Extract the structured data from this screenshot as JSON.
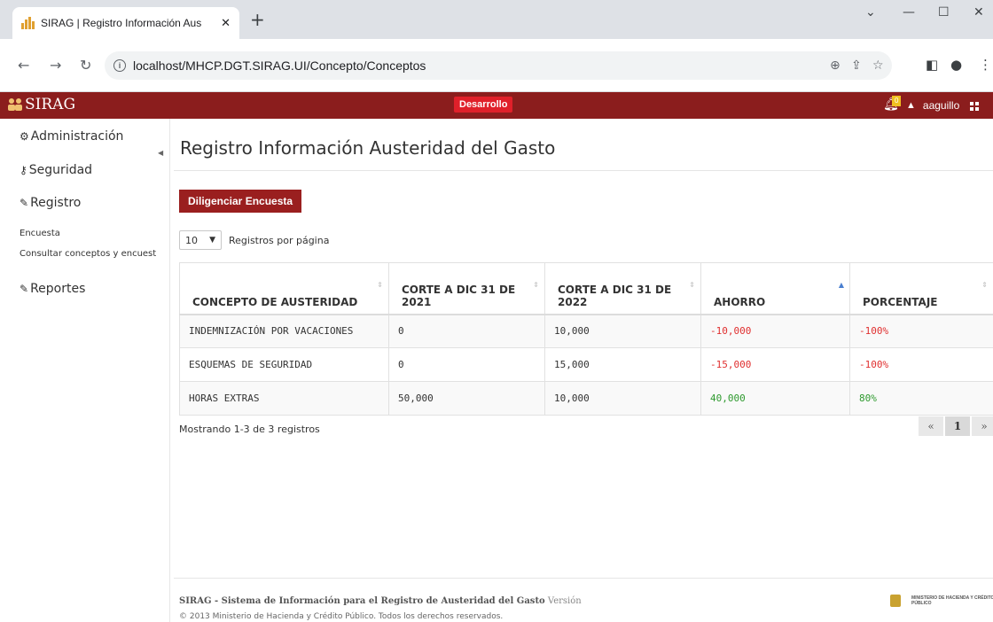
{
  "browser": {
    "tab_title": "SIRAG | Registro Información Aus",
    "url": "localhost/MHCP.DGT.SIRAG.UI/Concepto/Conceptos"
  },
  "header": {
    "brand": "SIRAG",
    "env_badge": "Desarrollo",
    "notif_count": "0",
    "username": "aaguillo",
    "bar_color": "#8b1d1d"
  },
  "sidebar": {
    "items": [
      {
        "label": "Administración",
        "icon": "gears-icon"
      },
      {
        "label": "Seguridad",
        "icon": "key-icon"
      },
      {
        "label": "Registro",
        "icon": "edit-icon"
      },
      {
        "label": "Reportes",
        "icon": "edit-icon"
      }
    ],
    "sub_items": [
      "Encuesta",
      "Consultar conceptos y encuest"
    ]
  },
  "main": {
    "title": "Registro Información Austeridad del Gasto",
    "action_button": "Diligenciar Encuesta",
    "per_page_value": "10",
    "per_page_label": "Registros por página",
    "table": {
      "columns": [
        "CONCEPTO DE AUSTERIDAD",
        "CORTE A DIC 31 DE 2021",
        "CORTE A DIC 31 DE 2022",
        "AHORRO",
        "PORCENTAJE"
      ],
      "rows": [
        [
          "INDEMNIZACIÓN POR VACACIONES",
          "0",
          "10,000",
          "-10,000",
          "-100%"
        ],
        [
          "ESQUEMAS DE SEGURIDAD",
          "0",
          "15,000",
          "-15,000",
          "-100%"
        ],
        [
          "HORAS EXTRAS",
          "50,000",
          "10,000",
          "40,000",
          "80%"
        ]
      ]
    },
    "info": "Mostrando 1-3 de 3 registros",
    "pager": {
      "prev": "«",
      "current": "1",
      "next": "»"
    }
  },
  "footer": {
    "system_name": "SIRAG - Sistema de Información para el Registro de Austeridad del Gasto",
    "version_label": "Versión",
    "copyright": "© 2013 Ministerio de Hacienda y Crédito Público. Todos los derechos reservados.",
    "ministry_logo_text": "MINISTERIO DE HACIENDA Y CRÉDITO PÚBLICO"
  },
  "colors": {
    "negative": "#e03030",
    "positive": "#2f9a2f",
    "accent": "#9a1f1f"
  }
}
